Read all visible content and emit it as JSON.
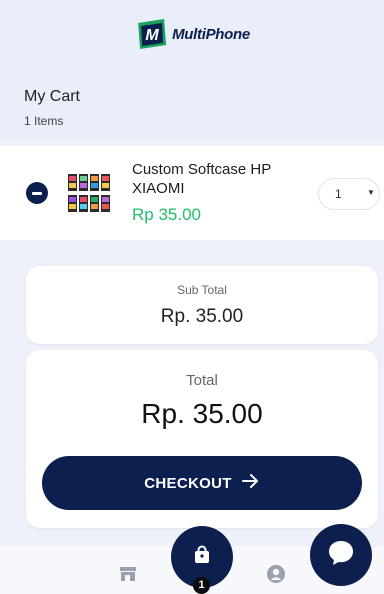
{
  "brand": {
    "name": "MultiPhone",
    "mark_letter": "M"
  },
  "cart": {
    "title": "My Cart",
    "count_text": "1 Items"
  },
  "item": {
    "name": "Custom Softcase HP XIAOMI",
    "price": "Rp 35.00",
    "quantity": "1"
  },
  "summary": {
    "subtotal_label": "Sub Total",
    "subtotal_value": "Rp. 35.00",
    "total_label": "Total",
    "total_value": "Rp. 35.00",
    "checkout_label": "CHECKOUT"
  },
  "nav": {
    "cart_badge": "1"
  },
  "icons": {
    "remove": "minus-circle-icon",
    "checkout_arrow": "arrow-right-icon",
    "store": "store-icon",
    "cart": "shopping-bag-icon",
    "profile": "user-circle-icon",
    "chat": "chat-bubble-icon"
  },
  "colors": {
    "primary": "#0d1f4f",
    "price": "#1fc06a",
    "logo_green": "#17a35a",
    "background": "#eef1fa"
  }
}
